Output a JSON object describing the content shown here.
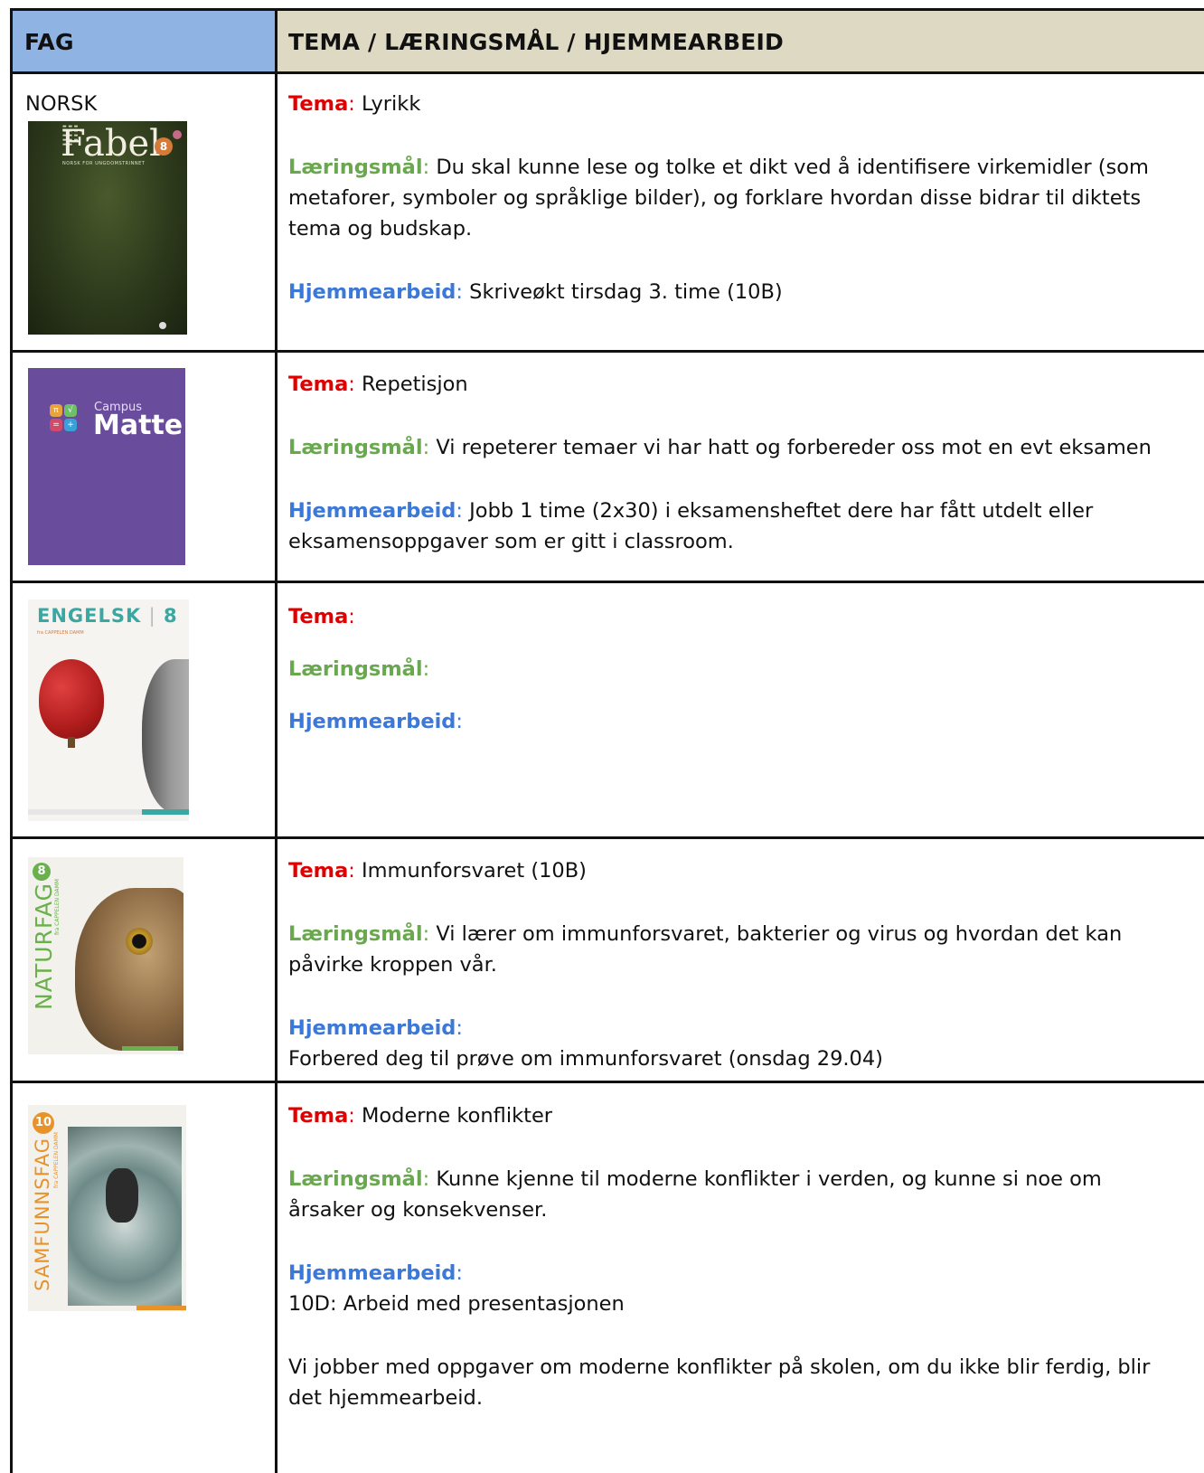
{
  "header": {
    "fag": "FAG",
    "tema": "TEMA / LÆRINGSMÅL / HJEMMEARBEID"
  },
  "labels": {
    "tema": "Tema",
    "laeringsmal": "Læringsmål",
    "hjemmearbeid": "Hjemmearbeid",
    "colon": ":"
  },
  "rows": [
    {
      "subject": "NORSK",
      "book": {
        "title": "Fabel",
        "level": "8",
        "subtitle": "NORSK FOR UNGDOMSTRINNET"
      },
      "tema": " Lyrikk",
      "laeringsmal": " Du skal kunne lese og tolke et dikt ved å identifisere virkemidler (som metaforer, symboler og språklige bilder), og forklare hvordan disse bidrar til diktets tema og budskap.",
      "hjemmearbeid": " Skriveøkt tirsdag 3. time (10B)"
    },
    {
      "book": {
        "brand": "Campus",
        "title": "Matte"
      },
      "tema": " Repetisjon",
      "laeringsmal": " Vi repeterer temaer vi har hatt og forbereder oss mot en evt eksamen",
      "hjemmearbeid": " Jobb 1 time (2x30) i eksamensheftet dere har fått utdelt eller eksamensoppgaver som er gitt i classroom."
    },
    {
      "book": {
        "title": "ENGELSK",
        "level": "8",
        "publisher": "fra CAPPELEN DAMM"
      },
      "tema": "",
      "laeringsmal": "",
      "hjemmearbeid": ""
    },
    {
      "book": {
        "title": "NATURFAG",
        "level": "8",
        "publisher": "fra CAPPELEN DAMM"
      },
      "tema": " Immunforsvaret (10B)",
      "laeringsmal": " Vi lærer om immunforsvaret, bakterier og virus og hvordan det kan påvirke kroppen vår.",
      "hjemmearbeid_lines": [
        "Forbered deg til prøve om immunforsvaret (onsdag 29.04)"
      ]
    },
    {
      "book": {
        "title": "SAMFUNNSFAG",
        "level": "10",
        "publisher": "fra CAPPELEN DAMM"
      },
      "tema": " Moderne konflikter",
      "laeringsmal": " Kunne kjenne til moderne konflikter i verden, og kunne si noe om årsaker og konsekvenser.",
      "hjemmearbeid_lines": [
        "10D: Arbeid med presentasjonen",
        "Vi jobber med oppgaver om moderne konflikter på skolen, om du ikke blir ferdig, blir det hjemmearbeid."
      ]
    }
  ],
  "colors": {
    "header_fag_bg": "#8fb4e3",
    "header_tema_bg": "#ddd9c3",
    "tema": "#e00000",
    "laeringsmal": "#6aa84f",
    "hjemmearbeid": "#3c78d8"
  }
}
